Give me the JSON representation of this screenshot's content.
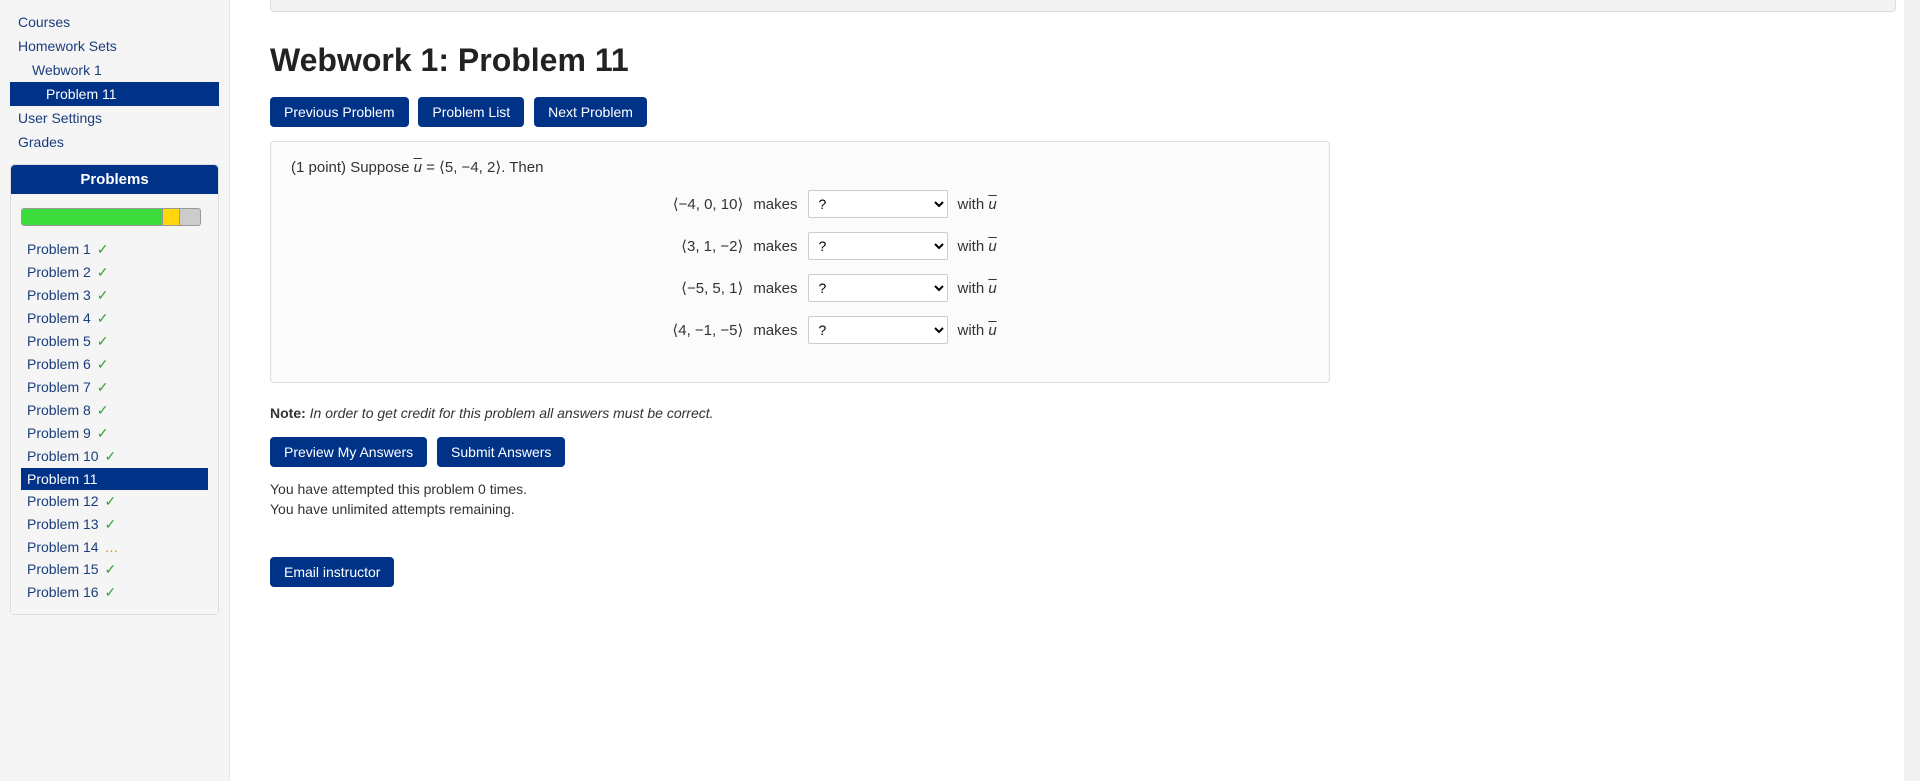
{
  "sidebar": {
    "nav": [
      {
        "label": "Courses",
        "indent": 0,
        "active": false
      },
      {
        "label": "Homework Sets",
        "indent": 0,
        "active": false
      },
      {
        "label": "Webwork 1",
        "indent": 1,
        "active": false
      },
      {
        "label": "Problem 11",
        "indent": 2,
        "active": true
      },
      {
        "label": "User Settings",
        "indent": 0,
        "active": false
      },
      {
        "label": "Grades",
        "indent": 0,
        "active": false
      }
    ],
    "problemsPanel": {
      "heading": "Problems",
      "items": [
        {
          "label": "Problem 1",
          "mark": "check",
          "active": false
        },
        {
          "label": "Problem 2",
          "mark": "check",
          "active": false
        },
        {
          "label": "Problem 3",
          "mark": "check",
          "active": false
        },
        {
          "label": "Problem 4",
          "mark": "check",
          "active": false
        },
        {
          "label": "Problem 5",
          "mark": "check",
          "active": false
        },
        {
          "label": "Problem 6",
          "mark": "check",
          "active": false
        },
        {
          "label": "Problem 7",
          "mark": "check",
          "active": false
        },
        {
          "label": "Problem 8",
          "mark": "check",
          "active": false
        },
        {
          "label": "Problem 9",
          "mark": "check",
          "active": false
        },
        {
          "label": "Problem 10",
          "mark": "check",
          "active": false
        },
        {
          "label": "Problem 11",
          "mark": "",
          "active": true
        },
        {
          "label": "Problem 12",
          "mark": "check",
          "active": false
        },
        {
          "label": "Problem 13",
          "mark": "check",
          "active": false
        },
        {
          "label": "Problem 14",
          "mark": "dots",
          "active": false
        },
        {
          "label": "Problem 15",
          "mark": "check",
          "active": false
        },
        {
          "label": "Problem 16",
          "mark": "check",
          "active": false
        }
      ]
    }
  },
  "main": {
    "title": "Webwork 1: Problem 11",
    "navButtons": {
      "prev": "Previous Problem",
      "list": "Problem List",
      "next": "Next Problem"
    },
    "problem": {
      "pointsPrefix": "(1 point) Suppose ",
      "uSymbol": "u",
      "equals": " = ",
      "uVector": "⟨5, −4, 2⟩",
      "thenText": ". Then",
      "rows": [
        {
          "vector": "⟨−4, 0, 10⟩",
          "verb": "makes",
          "selected": "?",
          "suffix1": "with ",
          "suffix2": "u"
        },
        {
          "vector": "⟨3, 1, −2⟩",
          "verb": "makes",
          "selected": "?",
          "suffix1": "with ",
          "suffix2": "u"
        },
        {
          "vector": "⟨−5, 5, 1⟩",
          "verb": "makes",
          "selected": "?",
          "suffix1": "with ",
          "suffix2": "u"
        },
        {
          "vector": "⟨4, −1, −5⟩",
          "verb": "makes",
          "selected": "?",
          "suffix1": "with ",
          "suffix2": "u"
        }
      ],
      "selectPlaceholder": "?"
    },
    "note": {
      "label": "Note:",
      "body": " In order to get credit for this problem all answers must be correct."
    },
    "answerButtons": {
      "preview": "Preview My Answers",
      "submit": "Submit Answers"
    },
    "status": {
      "line1": "You have attempted this problem 0 times.",
      "line2": "You have unlimited attempts remaining."
    },
    "emailButton": "Email instructor"
  }
}
